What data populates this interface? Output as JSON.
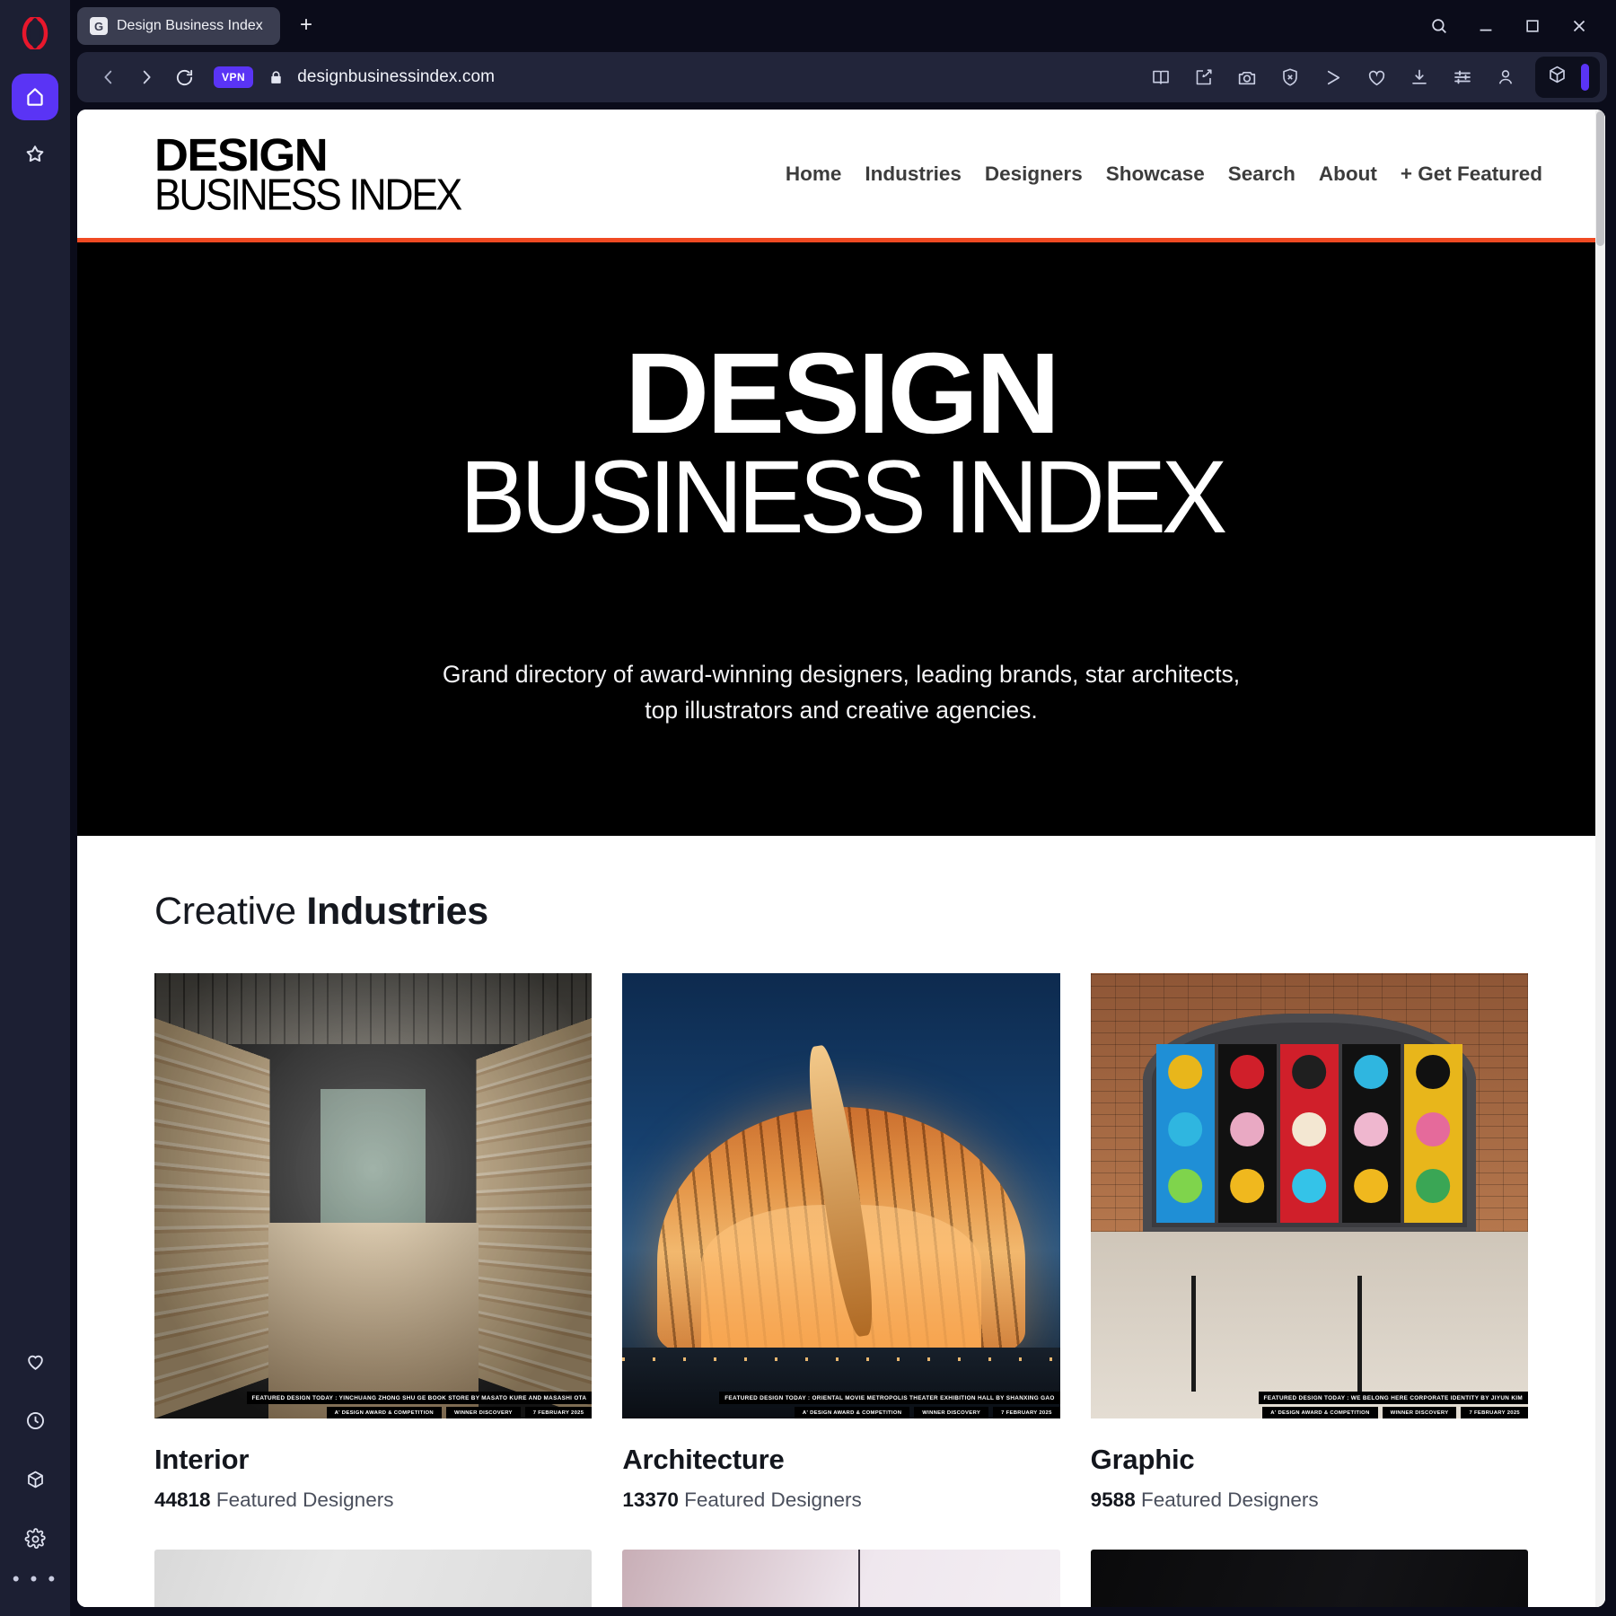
{
  "browser": {
    "name": "Opera",
    "tab": {
      "title": "Design Business Index",
      "favicon_letter": "G"
    },
    "new_tab_label": "+",
    "window_controls": {
      "search": "search-icon",
      "minimize": "minimize-icon",
      "maximize": "maximize-icon",
      "close": "close-icon"
    },
    "address": {
      "url": "designbusinessindex.com",
      "vpn_label": "VPN",
      "back": "back-arrow-icon",
      "forward": "forward-arrow-icon",
      "reload": "reload-icon",
      "lock": "lock-icon"
    },
    "address_icons": [
      "reader-book-icon",
      "pin-edit-icon",
      "snapshot-camera-icon",
      "ad-blocker-shield-icon",
      "send-share-icon",
      "heart-icon",
      "download-icon",
      "easy-setup-sliders-icon",
      "profile-icon"
    ],
    "extension_icons": [
      "extensions-cube-icon"
    ],
    "sidebar": {
      "top": [
        {
          "name": "home",
          "icon": "home-icon",
          "active": true
        },
        {
          "name": "bookmarks",
          "icon": "star-icon",
          "active": false
        }
      ],
      "bottom": [
        {
          "name": "favorites",
          "icon": "heart-icon"
        },
        {
          "name": "history",
          "icon": "clock-icon"
        },
        {
          "name": "extensions",
          "icon": "cube-icon"
        },
        {
          "name": "settings",
          "icon": "gear-icon"
        },
        {
          "name": "more",
          "icon": "ellipsis-icon"
        }
      ]
    }
  },
  "site": {
    "logo": {
      "line1": "DESIGN",
      "line2": "BUSINESS INDEX"
    },
    "accent_color": "#f04a23",
    "nav": [
      {
        "label": "Home"
      },
      {
        "label": "Industries"
      },
      {
        "label": "Designers"
      },
      {
        "label": "Showcase"
      },
      {
        "label": "Search"
      },
      {
        "label": "About"
      },
      {
        "label": "+ Get Featured"
      }
    ],
    "hero": {
      "title_line1": "DESIGN",
      "title_line2": "BUSINESS INDEX",
      "subtitle": "Grand directory of award-winning designers, leading brands, star architects, top illustrators and creative agencies."
    },
    "industries": {
      "heading_light": "Creative",
      "heading_bold": "Industries",
      "meta_suffix": "Featured Designers",
      "cards": [
        {
          "title": "Interior",
          "count": "44818",
          "meta_suffix": "Featured Designers",
          "caption": "FEATURED DESIGN TODAY : YINCHUANG ZHONG SHU GE BOOK STORE BY MASATO KURE AND MASASHI OTA",
          "chips": [
            "A' DESIGN AWARD & COMPETITION",
            "WINNER DISCOVERY",
            "7 FEBRUARY 2025"
          ],
          "image": "library-bookstore-photo"
        },
        {
          "title": "Architecture",
          "count": "13370",
          "meta_suffix": "Featured Designers",
          "caption": "FEATURED DESIGN TODAY : ORIENTAL MOVIE METROPOLIS THEATER EXHIBITION HALL BY SHANXING GAO",
          "chips": [
            "A' DESIGN AWARD & COMPETITION",
            "WINNER DISCOVERY",
            "7 FEBRUARY 2025"
          ],
          "image": "theater-exhibition-hall-photo"
        },
        {
          "title": "Graphic",
          "count": "9588",
          "meta_suffix": "Featured Designers",
          "caption": "FEATURED DESIGN TODAY : WE BELONG HERE CORPORATE IDENTITY BY JIYUN KIM",
          "chips": [
            "A' DESIGN AWARD & COMPETITION",
            "WINNER DISCOVERY",
            "7 FEBRUARY 2025"
          ],
          "image": "poster-wall-identity-photo"
        }
      ]
    }
  }
}
